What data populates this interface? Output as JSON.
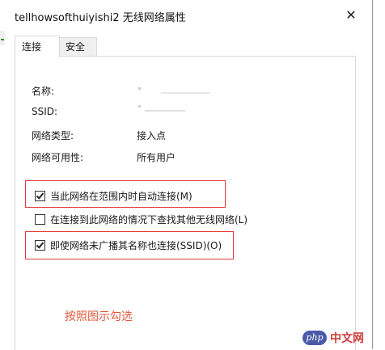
{
  "window": {
    "title": "tellhowsofthuiyishi2 无线网络属性",
    "close_glyph": "✕"
  },
  "tabs": [
    {
      "label": "连接",
      "active": true
    },
    {
      "label": "安全",
      "active": false
    }
  ],
  "properties": [
    {
      "label": "名称:",
      "value": ""
    },
    {
      "label": "SSID:",
      "value": ""
    },
    {
      "label": "网络类型:",
      "value": "接入点"
    },
    {
      "label": "网络可用性:",
      "value": "所有用户"
    }
  ],
  "options": [
    {
      "label": "当此网络在范围内时自动连接(M)",
      "checked": true,
      "highlighted": true
    },
    {
      "label": "在连接到此网络的情况下查找其他无线网络(L)",
      "checked": false,
      "highlighted": false
    },
    {
      "label": "即使网络未广播其名称也连接(SSID)(O)",
      "checked": true,
      "highlighted": true
    }
  ],
  "annotation": "按照图示勾选",
  "watermark": {
    "logo": "php",
    "text": "中文网"
  },
  "colors": {
    "highlight": "#e23b3b",
    "annotation": "#e05a3a"
  }
}
